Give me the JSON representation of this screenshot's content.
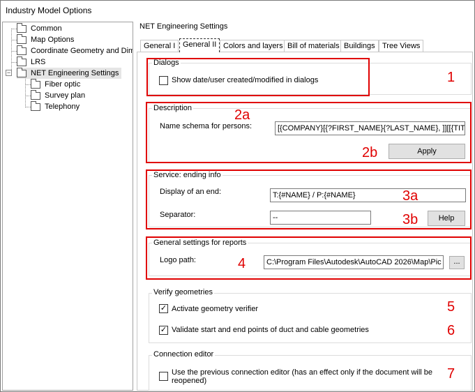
{
  "window": {
    "title": "Industry Model Options"
  },
  "tree": {
    "items": [
      {
        "label": "Common"
      },
      {
        "label": "Map Options"
      },
      {
        "label": "Coordinate Geometry and Dime"
      },
      {
        "label": "LRS"
      },
      {
        "label": "NET Engineering Settings",
        "expander": "−"
      },
      {
        "label": "Fiber optic"
      },
      {
        "label": "Survey plan"
      },
      {
        "label": "Telephony"
      }
    ]
  },
  "panel": {
    "title": "NET Engineering Settings",
    "tabs": [
      {
        "label": "General I"
      },
      {
        "label": "General II"
      },
      {
        "label": "Colors and layers"
      },
      {
        "label": "Bill of materials"
      },
      {
        "label": "Buildings"
      },
      {
        "label": "Tree Views"
      }
    ]
  },
  "dialogs": {
    "title": "Dialogs",
    "checkbox_label": "Show date/user created/modified in dialogs",
    "checked": false
  },
  "description": {
    "title": "Description",
    "name_schema_label": "Name schema for persons:",
    "name_schema_value": "[{COMPANY}[{?FIRST_NAME}{?LAST_NAME}, ]][[{TIT",
    "apply_label": "Apply"
  },
  "service": {
    "title": "Service: ending info",
    "display_label": "Display of an end:",
    "display_value": "T:{#NAME} / P:{#NAME}",
    "separator_label": "Separator:",
    "separator_value": "--",
    "help_label": "Help"
  },
  "reports": {
    "title": "General settings for reports",
    "logo_label": "Logo path:",
    "logo_value": "C:\\Program Files\\Autodesk\\AutoCAD 2026\\Map\\Pic",
    "browse_label": "..."
  },
  "verify": {
    "title": "Verify geometries",
    "verifier_label": "Activate geometry verifier",
    "verifier_checked": true,
    "validate_label": "Validate start and end points of duct and cable geometries",
    "validate_checked": true
  },
  "connection": {
    "title": "Connection editor",
    "prev_label": "Use the previous connection editor (has an effect only if the document will be reopened)",
    "prev_checked": false
  },
  "annotations": {
    "n1": "1",
    "n2a": "2a",
    "n2b": "2b",
    "n3a": "3a",
    "n3b": "3b",
    "n4": "4",
    "n5": "5",
    "n6": "6",
    "n7": "7",
    "color": "#e00000"
  }
}
